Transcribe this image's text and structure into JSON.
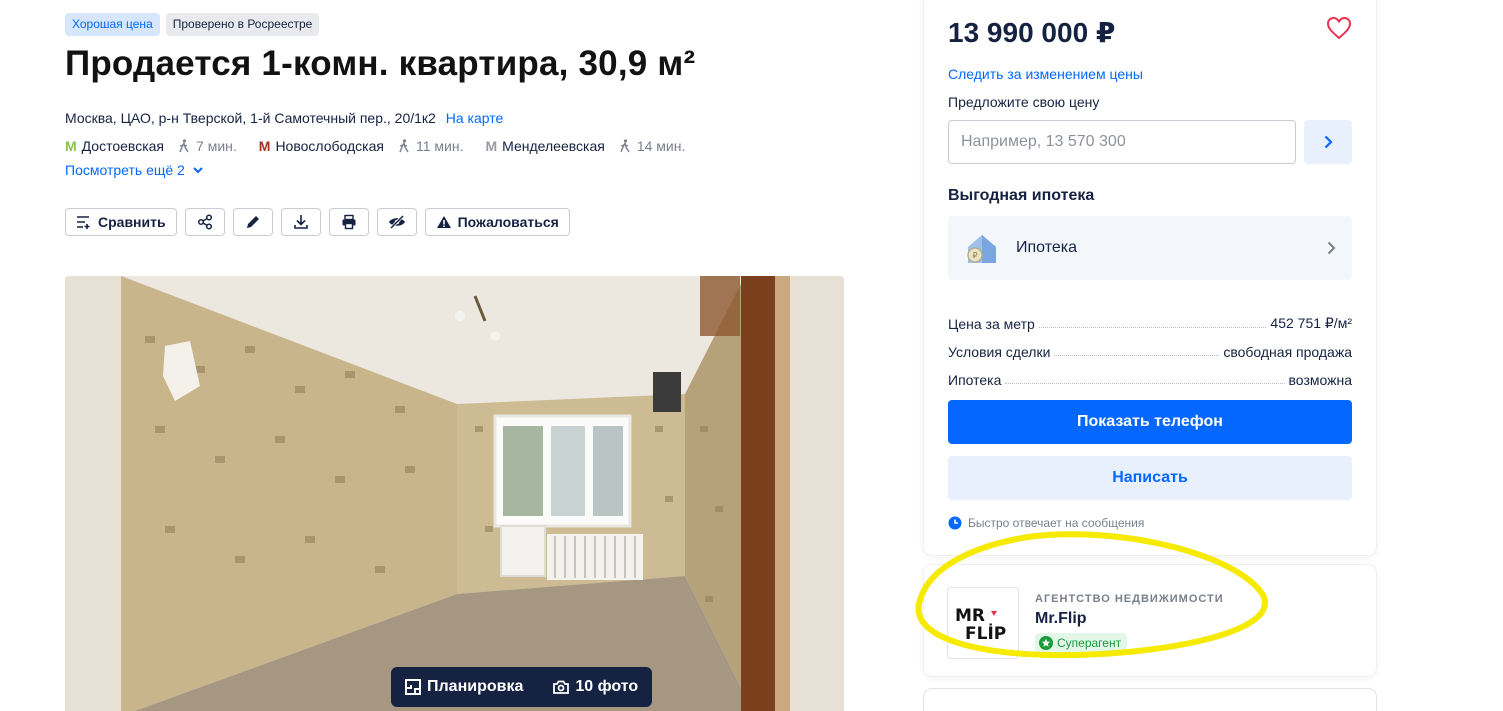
{
  "badges": [
    "Хорошая цена",
    "Проверено в Росреестре"
  ],
  "title": "Продается 1-комн. квартира, 30,9 м²",
  "address": {
    "text": "Москва, ЦАО, р-н Тверской, 1-й Самотечный пер., 20/1к2",
    "map_link": "На карте"
  },
  "metro": [
    {
      "name": "Достоевская",
      "time": "7 мин.",
      "color": "#8bc34a"
    },
    {
      "name": "Новослободская",
      "time": "11 мин.",
      "color": "#a0341f"
    },
    {
      "name": "Менделеевская",
      "time": "14 мин.",
      "color": "#9a9ca3"
    }
  ],
  "more_link": "Посмотреть ещё 2",
  "toolbar": {
    "compare": "Сравнить",
    "share_icon": "share-icon",
    "edit_icon": "pencil-icon",
    "download_icon": "download-icon",
    "print_icon": "print-icon",
    "hide_icon": "hide-eye-icon",
    "complain": "Пожаловаться"
  },
  "photo": {
    "plan_label": "Планировка",
    "photos_label": "10 фото"
  },
  "sidebar": {
    "price": "13 990 000 ₽",
    "follow_price": "Следить за изменением цены",
    "offer_label": "Предложите свою цену",
    "offer_placeholder": "Например, 13 570 300",
    "mortgage_title": "Выгодная ипотека",
    "mortgage_item": "Ипотека",
    "facts": [
      {
        "label": "Цена за метр",
        "value": "452 751 ₽/м²"
      },
      {
        "label": "Условия сделки",
        "value": "свободная продажа"
      },
      {
        "label": "Ипотека",
        "value": "возможна"
      }
    ],
    "show_phone": "Показать телефон",
    "write": "Написать",
    "reply_note": "Быстро отвечает на сообщения"
  },
  "agent": {
    "type": "АГЕНТСТВО НЕДВИЖИМОСТИ",
    "name": "Mr.Flip",
    "badge": "Суперагент",
    "logo_text": "MR.FLIP"
  },
  "colors": {
    "accent": "#0468ff",
    "text": "#152242",
    "highlight": "#f5ea00"
  }
}
